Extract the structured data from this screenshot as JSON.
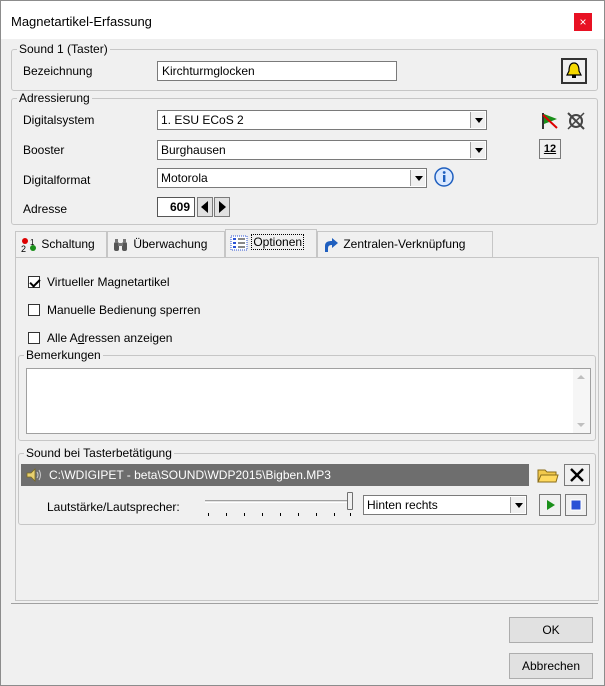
{
  "window": {
    "title": "Magnetartikel-Erfassung",
    "close_glyph": "×"
  },
  "sound_group": {
    "label": "Sound 1 (Taster)",
    "bezeichnung_label": "Bezeichnung",
    "bezeichnung_value": "Kirchturmglocken",
    "bell_icon": "bell-icon"
  },
  "adress_group": {
    "label": "Adressierung",
    "digitalsystem_label": "Digitalsystem",
    "digitalsystem_value": "1. ESU ECoS 2",
    "booster_label": "Booster",
    "booster_value": "Burghausen",
    "digitalformat_label": "Digitalformat",
    "digitalformat_value": "Motorola",
    "adresse_label": "Adresse",
    "adresse_value": "609",
    "number_badge": "12"
  },
  "tabs": [
    {
      "label": "Schaltung",
      "icon": "switch-icon"
    },
    {
      "label": "Überwachung",
      "icon": "binoculars-icon"
    },
    {
      "label": "Optionen",
      "icon": "options-icon"
    },
    {
      "label": "Zentralen-Verknüpfung",
      "icon": "arrow-link-icon"
    }
  ],
  "options": {
    "virtueller": {
      "label": "Virtueller Magnetartikel",
      "checked": true
    },
    "manuelle": {
      "label": "Manuelle Bedienung sperren",
      "checked": false
    },
    "alle_pre": "Alle A",
    "alle_accel": "d",
    "alle_post": "ressen anzeigen",
    "alle_checked": false
  },
  "bemerkungen": {
    "label": "Bemerkungen",
    "value": ""
  },
  "sound_bei": {
    "label": "Sound bei Tasterbetätigung",
    "path": "C:\\WDIGIPET - beta\\SOUND\\WDP2015\\Bigben.MP3",
    "lautstaerke_label": "Lautstärke/Lautsprecher:",
    "volume_level": 1.0,
    "speaker_value": "Hinten rechts"
  },
  "buttons": {
    "ok": "OK",
    "abbrechen": "Abbrechen"
  },
  "colors": {
    "accent_red": "#e81123",
    "path_bg": "#6e6e6e",
    "play_green": "#1a8f1a",
    "stop_blue": "#2a52d6"
  }
}
